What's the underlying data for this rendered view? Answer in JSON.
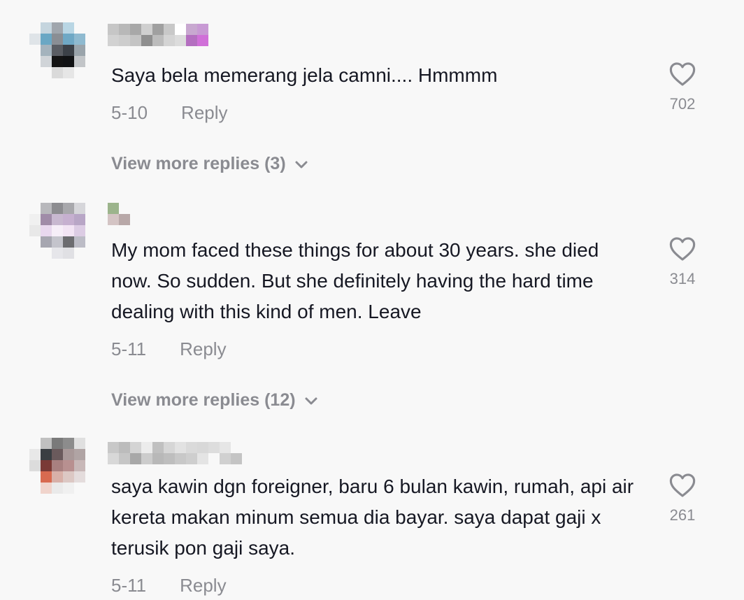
{
  "comments": [
    {
      "text": "Saya bela memerang jela camni.... Hmmmm",
      "date": "5-10",
      "reply_label": "Reply",
      "likes": "702",
      "view_more": "View more replies (3)",
      "avatar_colors": [
        "#f8f8f8",
        "#c5d5de",
        "#a0a6ad",
        "#b9d6e4",
        "#f8f8f8",
        "#f8f8f8",
        "#dfe4e8",
        "#6aa7c4",
        "#8a8e94",
        "#6fa8c5",
        "#8fbad0",
        "#f8f8f8",
        "#f8f8f8",
        "#a4b3bd",
        "#5a5d63",
        "#3c4148",
        "#9aa4ab",
        "#f8f8f8",
        "#f8f8f8",
        "#d0d4d8",
        "#141414",
        "#111214",
        "#c2c5c8",
        "#f8f8f8",
        "#f8f8f8",
        "#f8f8f8",
        "#dadada",
        "#e6e6e6",
        "#f8f8f8",
        "#f8f8f8",
        "#f8f8f8",
        "#f8f8f8",
        "#f8f8f8",
        "#f8f8f8",
        "#f8f8f8",
        "#f8f8f8"
      ],
      "username_colors": [
        "#c6c6c6",
        "#d2d2d2",
        "#b8b8b8",
        "#cdcdcd",
        "#a8a8a8",
        "#c4c4c4",
        "#cfcfcf",
        "#8f8f8f",
        "#a0a0a0",
        "#bcbcbc",
        "#c8c8c8",
        "#d4d4d4",
        "#ffffff",
        "#dcdcdc",
        "#c8a8d0",
        "#b46fc0",
        "#c89ad4",
        "#d070d8"
      ]
    },
    {
      "text": "My mom faced these things for about 30 years. she died now. So sudden. But she definitely having the hard time dealing with this kind of men. Leave",
      "date": "5-11",
      "reply_label": "Reply",
      "likes": "314",
      "view_more": "View more replies (12)",
      "avatar_colors": [
        "#f8f8f8",
        "#b8b8bc",
        "#8c8c90",
        "#a8a8ac",
        "#d6d6da",
        "#f8f8f8",
        "#f0f0f0",
        "#a08ca8",
        "#c8b8d0",
        "#c6b0d0",
        "#b8a6c6",
        "#f8f8f8",
        "#e8e8e8",
        "#e8d8ee",
        "#f6eef8",
        "#f2e4f4",
        "#dccce4",
        "#f8f8f8",
        "#f8f8f8",
        "#a6a6b0",
        "#c4c4cc",
        "#6c6c70",
        "#bcbcc6",
        "#f8f8f8",
        "#f8f8f8",
        "#f8f8f8",
        "#e6e6ea",
        "#e0e0e4",
        "#f8f8f8",
        "#f8f8f8",
        "#f8f8f8",
        "#f8f8f8",
        "#f8f8f8",
        "#f8f8f8",
        "#f8f8f8",
        "#f8f8f8"
      ],
      "username_colors": [
        "#9cb48c",
        "#d4c4c4",
        "#f8f8f8",
        "#b8a8a8"
      ]
    },
    {
      "text": "saya kawin dgn foreigner, baru 6 bulan kawin, rumah, api air kereta makan minum semua dia bayar. saya dapat gaji x terusik pon gaji saya.",
      "date": "5-11",
      "reply_label": "Reply",
      "likes": "261",
      "view_more": "",
      "avatar_colors": [
        "#f8f8f8",
        "#c0c0c0",
        "#7a7a7a",
        "#8c8c8c",
        "#e0e0e0",
        "#f8f8f8",
        "#e8e8e8",
        "#3a3e42",
        "#6a5a5c",
        "#a89898",
        "#b0a4a4",
        "#f8f8f8",
        "#dcdcdc",
        "#7a3a36",
        "#a88080",
        "#b89090",
        "#c8b8b8",
        "#f8f8f8",
        "#f8f8f8",
        "#d86a50",
        "#d8b0a8",
        "#dcc8c4",
        "#e4dcdc",
        "#f8f8f8",
        "#f8f8f8",
        "#f0d4cc",
        "#eaeaea",
        "#f0f0f0",
        "#f8f8f8",
        "#f8f8f8",
        "#f8f8f8",
        "#f8f8f8",
        "#f8f8f8",
        "#f8f8f8",
        "#f8f8f8",
        "#f8f8f8"
      ],
      "username_colors": [
        "#c8c8c8",
        "#d8d8d8",
        "#bcbcbc",
        "#c6c6c6",
        "#d4d4d4",
        "#a8a8a8",
        "#ececec",
        "#cccccc",
        "#c0c0c0",
        "#b8b8b8",
        "#d6d6d6",
        "#bebebe",
        "#e2e2e2",
        "#c8c8c8",
        "#dadada",
        "#cecece",
        "#d8d8d8",
        "#e4e4e4",
        "#dddddd",
        "#f8f8f8",
        "#e6e6e6",
        "#d0d0d0",
        "#f8f8f8",
        "#c4c4c4"
      ]
    }
  ],
  "colors": {
    "background": "#f8f8f8",
    "text": "#161823",
    "secondary": "#8a8b91"
  }
}
